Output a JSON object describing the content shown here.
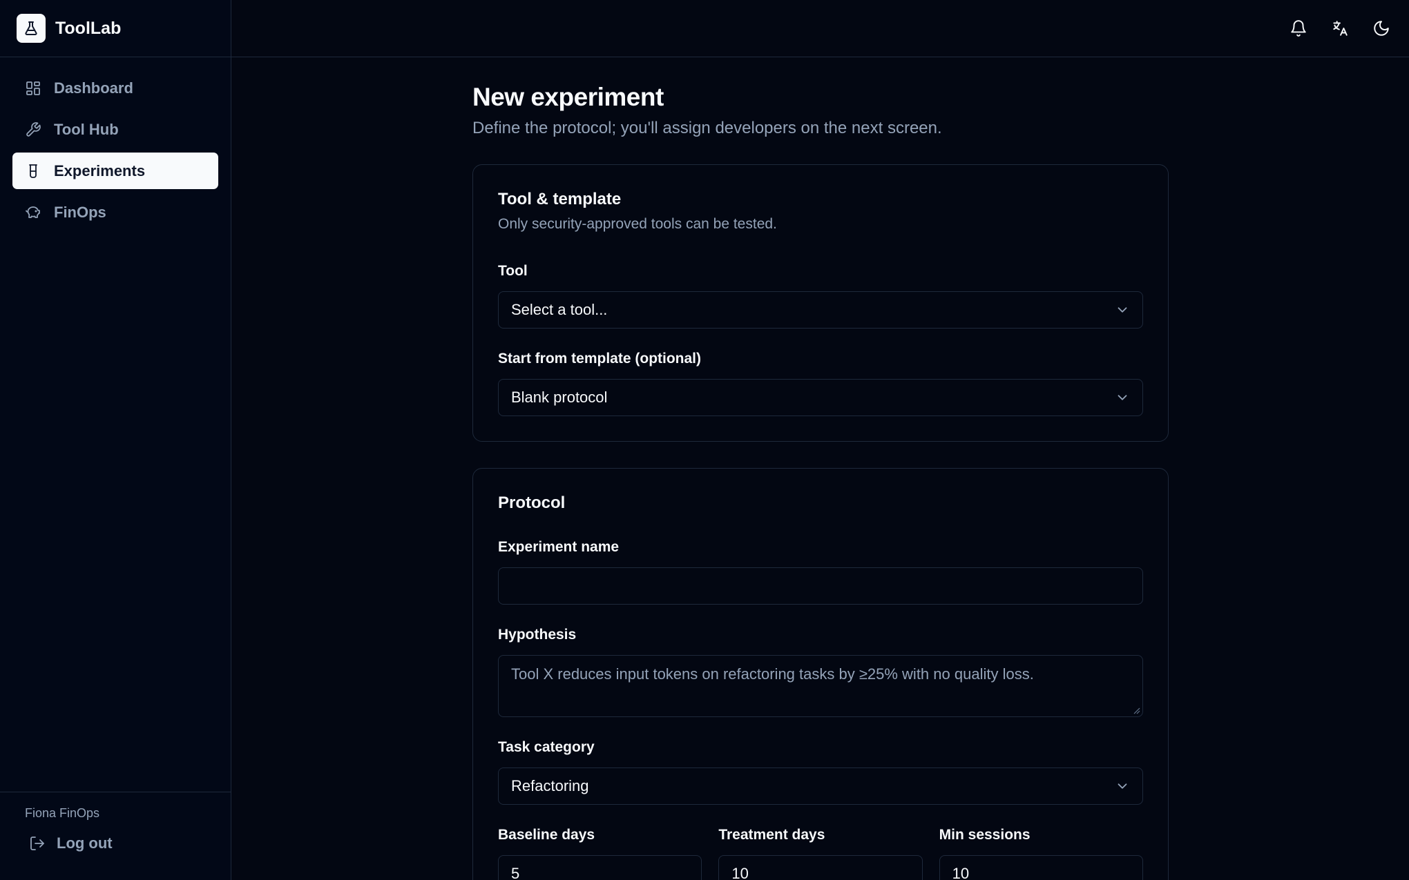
{
  "app": {
    "name": "ToolLab",
    "logo_icon": "flask-icon"
  },
  "sidebar": {
    "items": [
      {
        "label": "Dashboard",
        "icon": "dashboard-icon",
        "active": false
      },
      {
        "label": "Tool Hub",
        "icon": "wrench-icon",
        "active": false
      },
      {
        "label": "Experiments",
        "icon": "beaker-icon",
        "active": true
      },
      {
        "label": "FinOps",
        "icon": "piggy-bank-icon",
        "active": false
      }
    ],
    "user_name": "Fiona FinOps",
    "logout_label": "Log out"
  },
  "topbar": {
    "icons": [
      "bell-icon",
      "translate-icon",
      "moon-icon"
    ]
  },
  "page": {
    "title": "New experiment",
    "subtitle": "Define the protocol; you'll assign developers on the next screen."
  },
  "tool_card": {
    "title": "Tool & template",
    "subtitle": "Only security-approved tools can be tested.",
    "tool_label": "Tool",
    "tool_value": "Select a tool...",
    "template_label": "Start from template (optional)",
    "template_value": "Blank protocol"
  },
  "protocol_card": {
    "title": "Protocol",
    "name_label": "Experiment name",
    "name_value": "",
    "hypothesis_label": "Hypothesis",
    "hypothesis_placeholder": "Tool X reduces input tokens on refactoring tasks by ≥25% with no quality loss.",
    "category_label": "Task category",
    "category_value": "Refactoring",
    "baseline_label": "Baseline days",
    "baseline_value": "5",
    "treatment_label": "Treatment days",
    "treatment_value": "10",
    "min_sessions_label": "Min sessions",
    "min_sessions_value": "10"
  },
  "colors": {
    "background": "#030712",
    "border": "#1e293b",
    "muted": "#94a3b8",
    "active_bg": "#f8fafc"
  }
}
